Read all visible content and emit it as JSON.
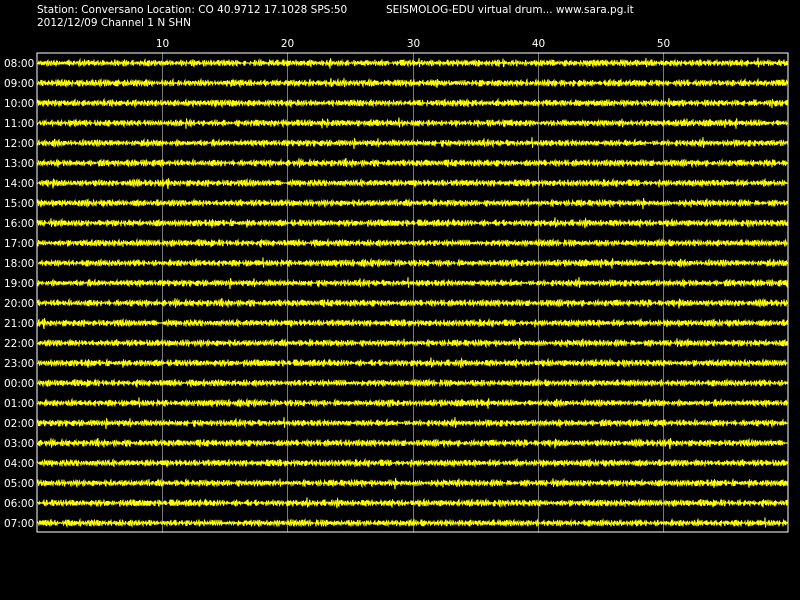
{
  "header": {
    "station_line": "Station: Conversano Location: CO 40.9712 17.1028 SPS:50",
    "date_line": "2012/12/09  Channel 1 N SHN",
    "app_line": "SEISMOLOG-EDU virtual drum... www.sara.pg.it"
  },
  "colors": {
    "background": "#000000",
    "trace": "#ffff00",
    "grid": "#ffffff",
    "text": "#ffffff"
  },
  "chart_data": {
    "type": "line",
    "title": "",
    "xlabel": "",
    "ylabel": "",
    "x_ticks": [
      10,
      20,
      30,
      40,
      50
    ],
    "xlim": [
      0,
      60
    ],
    "grid": true,
    "traces": [
      {
        "label": "08:00"
      },
      {
        "label": "09:00"
      },
      {
        "label": "10:00"
      },
      {
        "label": "11:00"
      },
      {
        "label": "12:00"
      },
      {
        "label": "13:00"
      },
      {
        "label": "14:00"
      },
      {
        "label": "15:00"
      },
      {
        "label": "16:00"
      },
      {
        "label": "17:00"
      },
      {
        "label": "18:00"
      },
      {
        "label": "19:00"
      },
      {
        "label": "20:00"
      },
      {
        "label": "21:00"
      },
      {
        "label": "22:00"
      },
      {
        "label": "23:00"
      },
      {
        "label": "00:00"
      },
      {
        "label": "01:00"
      },
      {
        "label": "02:00"
      },
      {
        "label": "03:00"
      },
      {
        "label": "04:00"
      },
      {
        "label": "05:00"
      },
      {
        "label": "06:00"
      },
      {
        "label": "07:00"
      }
    ]
  }
}
